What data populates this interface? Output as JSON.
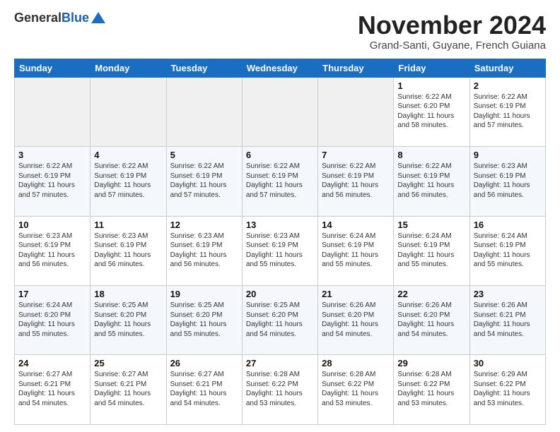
{
  "logo": {
    "general": "General",
    "blue": "Blue"
  },
  "title": "November 2024",
  "location": "Grand-Santi, Guyane, French Guiana",
  "days_of_week": [
    "Sunday",
    "Monday",
    "Tuesday",
    "Wednesday",
    "Thursday",
    "Friday",
    "Saturday"
  ],
  "weeks": [
    [
      {
        "num": "",
        "info": ""
      },
      {
        "num": "",
        "info": ""
      },
      {
        "num": "",
        "info": ""
      },
      {
        "num": "",
        "info": ""
      },
      {
        "num": "",
        "info": ""
      },
      {
        "num": "1",
        "info": "Sunrise: 6:22 AM\nSunset: 6:20 PM\nDaylight: 11 hours and 58 minutes."
      },
      {
        "num": "2",
        "info": "Sunrise: 6:22 AM\nSunset: 6:19 PM\nDaylight: 11 hours and 57 minutes."
      }
    ],
    [
      {
        "num": "3",
        "info": "Sunrise: 6:22 AM\nSunset: 6:19 PM\nDaylight: 11 hours and 57 minutes."
      },
      {
        "num": "4",
        "info": "Sunrise: 6:22 AM\nSunset: 6:19 PM\nDaylight: 11 hours and 57 minutes."
      },
      {
        "num": "5",
        "info": "Sunrise: 6:22 AM\nSunset: 6:19 PM\nDaylight: 11 hours and 57 minutes."
      },
      {
        "num": "6",
        "info": "Sunrise: 6:22 AM\nSunset: 6:19 PM\nDaylight: 11 hours and 57 minutes."
      },
      {
        "num": "7",
        "info": "Sunrise: 6:22 AM\nSunset: 6:19 PM\nDaylight: 11 hours and 56 minutes."
      },
      {
        "num": "8",
        "info": "Sunrise: 6:22 AM\nSunset: 6:19 PM\nDaylight: 11 hours and 56 minutes."
      },
      {
        "num": "9",
        "info": "Sunrise: 6:23 AM\nSunset: 6:19 PM\nDaylight: 11 hours and 56 minutes."
      }
    ],
    [
      {
        "num": "10",
        "info": "Sunrise: 6:23 AM\nSunset: 6:19 PM\nDaylight: 11 hours and 56 minutes."
      },
      {
        "num": "11",
        "info": "Sunrise: 6:23 AM\nSunset: 6:19 PM\nDaylight: 11 hours and 56 minutes."
      },
      {
        "num": "12",
        "info": "Sunrise: 6:23 AM\nSunset: 6:19 PM\nDaylight: 11 hours and 56 minutes."
      },
      {
        "num": "13",
        "info": "Sunrise: 6:23 AM\nSunset: 6:19 PM\nDaylight: 11 hours and 55 minutes."
      },
      {
        "num": "14",
        "info": "Sunrise: 6:24 AM\nSunset: 6:19 PM\nDaylight: 11 hours and 55 minutes."
      },
      {
        "num": "15",
        "info": "Sunrise: 6:24 AM\nSunset: 6:19 PM\nDaylight: 11 hours and 55 minutes."
      },
      {
        "num": "16",
        "info": "Sunrise: 6:24 AM\nSunset: 6:19 PM\nDaylight: 11 hours and 55 minutes."
      }
    ],
    [
      {
        "num": "17",
        "info": "Sunrise: 6:24 AM\nSunset: 6:20 PM\nDaylight: 11 hours and 55 minutes."
      },
      {
        "num": "18",
        "info": "Sunrise: 6:25 AM\nSunset: 6:20 PM\nDaylight: 11 hours and 55 minutes."
      },
      {
        "num": "19",
        "info": "Sunrise: 6:25 AM\nSunset: 6:20 PM\nDaylight: 11 hours and 55 minutes."
      },
      {
        "num": "20",
        "info": "Sunrise: 6:25 AM\nSunset: 6:20 PM\nDaylight: 11 hours and 54 minutes."
      },
      {
        "num": "21",
        "info": "Sunrise: 6:26 AM\nSunset: 6:20 PM\nDaylight: 11 hours and 54 minutes."
      },
      {
        "num": "22",
        "info": "Sunrise: 6:26 AM\nSunset: 6:20 PM\nDaylight: 11 hours and 54 minutes."
      },
      {
        "num": "23",
        "info": "Sunrise: 6:26 AM\nSunset: 6:21 PM\nDaylight: 11 hours and 54 minutes."
      }
    ],
    [
      {
        "num": "24",
        "info": "Sunrise: 6:27 AM\nSunset: 6:21 PM\nDaylight: 11 hours and 54 minutes."
      },
      {
        "num": "25",
        "info": "Sunrise: 6:27 AM\nSunset: 6:21 PM\nDaylight: 11 hours and 54 minutes."
      },
      {
        "num": "26",
        "info": "Sunrise: 6:27 AM\nSunset: 6:21 PM\nDaylight: 11 hours and 54 minutes."
      },
      {
        "num": "27",
        "info": "Sunrise: 6:28 AM\nSunset: 6:22 PM\nDaylight: 11 hours and 53 minutes."
      },
      {
        "num": "28",
        "info": "Sunrise: 6:28 AM\nSunset: 6:22 PM\nDaylight: 11 hours and 53 minutes."
      },
      {
        "num": "29",
        "info": "Sunrise: 6:28 AM\nSunset: 6:22 PM\nDaylight: 11 hours and 53 minutes."
      },
      {
        "num": "30",
        "info": "Sunrise: 6:29 AM\nSunset: 6:22 PM\nDaylight: 11 hours and 53 minutes."
      }
    ]
  ]
}
